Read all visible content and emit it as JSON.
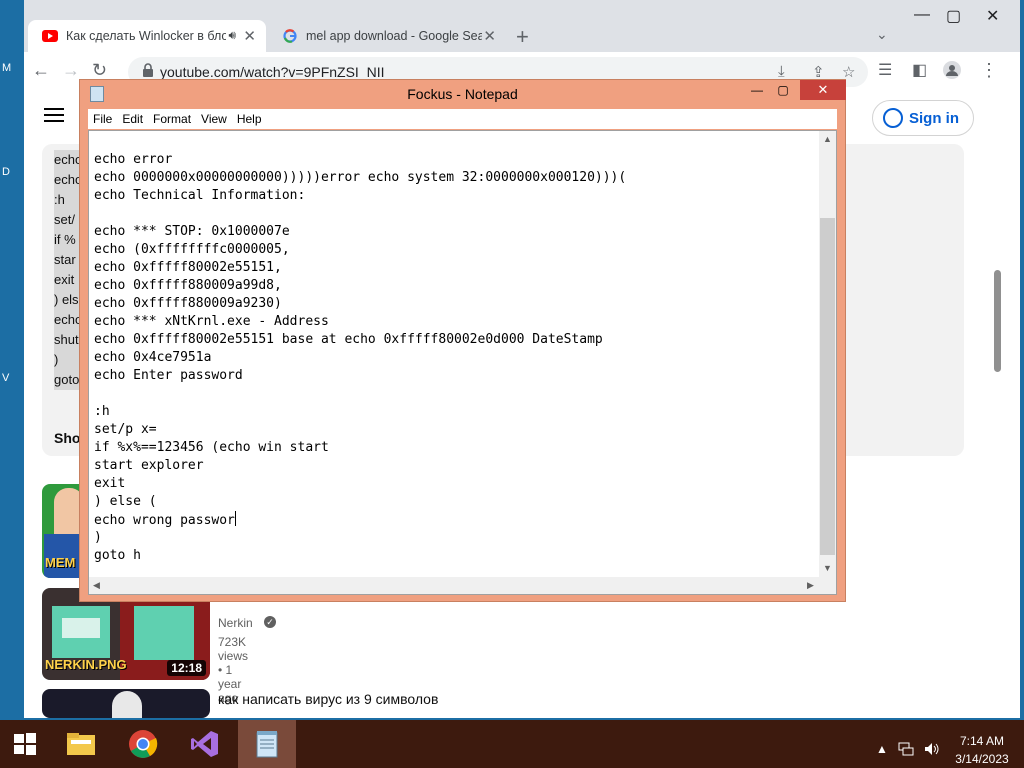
{
  "browser": {
    "tabs": [
      {
        "title": "Как сделать Winlocker в бло",
        "active": true
      },
      {
        "title": "mel app download - Google Sea",
        "active": false
      }
    ],
    "new_tab": "+",
    "url": "youtube.com/watch?v=9PFnZSI_NII"
  },
  "youtube": {
    "sign_in": "Sign in",
    "desc_lines": [
      "echo",
      "echo",
      "",
      ":h",
      "set/",
      "if %",
      "star",
      "exit",
      ") els",
      "echo",
      "shut",
      ")",
      "goto"
    ],
    "show_more": "Sho",
    "videos": [
      {
        "title": "",
        "channel": "",
        "meta": "",
        "duration": "",
        "caption": "MEM"
      },
      {
        "title": "",
        "channel": "Nerkin",
        "meta": "723K views  • 1 year ago",
        "duration": "12:18",
        "caption": "NERKIN.PNG"
      },
      {
        "title": "как написать вирус из 9 символов",
        "channel": "",
        "meta": "",
        "duration": "",
        "caption": ""
      }
    ]
  },
  "notepad": {
    "title": "Fockus - Notepad",
    "menu": [
      "File",
      "Edit",
      "Format",
      "View",
      "Help"
    ],
    "lines": [
      "echo error",
      "echo 0000000x00000000000)))))error echo system 32:0000000x000120)))(",
      "echo Technical Information:",
      "",
      "echo *** STOP: 0x1000007e",
      "echo (0xffffffffc0000005,",
      "echo 0xfffff80002e55151,",
      "echo 0xfffff880009a99d8,",
      "echo 0xfffff880009a9230)",
      "echo *** xNtKrnl.exe - Address",
      "echo 0xfffff80002e55151 base at echo 0xfffff80002e0d000 DateStamp",
      "echo 0x4ce7951a",
      "echo Enter password",
      "",
      ":h",
      "set/p x=",
      "if %x%==123456 (echo win start",
      "start explorer",
      "exit",
      ") else (",
      "echo wrong passwor",
      ")",
      "goto h"
    ]
  },
  "taskbar": {
    "items": [
      "start-button",
      "file-explorer-icon",
      "chrome-icon",
      "visual-studio-icon",
      "notepad-icon"
    ],
    "time": "7:14 AM",
    "date": "3/14/2023"
  },
  "desktop": {
    "labels": [
      "M",
      "D",
      "V"
    ]
  },
  "colors": {
    "notepad_frame": "#f0a080",
    "taskbar": "#3d1a0e",
    "youtube_red": "#ff0000",
    "link_blue": "#065fd4"
  }
}
